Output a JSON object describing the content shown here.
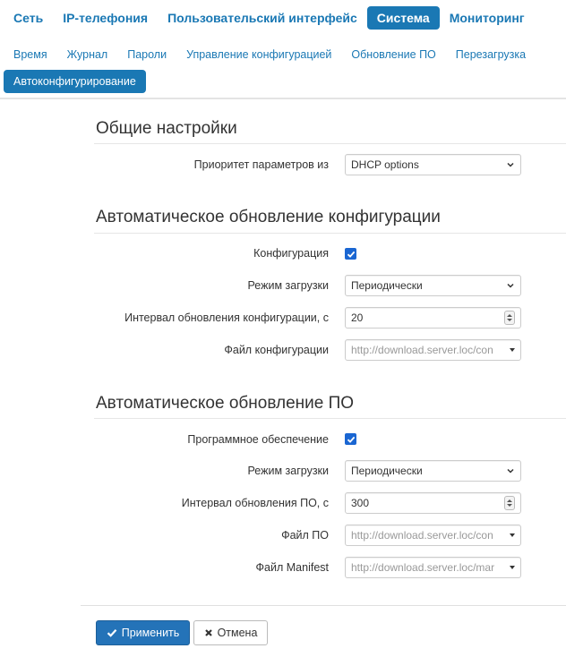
{
  "topnav": {
    "items": [
      "Сеть",
      "IP-телефония",
      "Пользовательский интерфейс",
      "Система",
      "Мониторинг"
    ],
    "active": "Система"
  },
  "subnav": {
    "items": [
      "Время",
      "Журнал",
      "Пароли",
      "Управление конфигурацией",
      "Обновление ПО",
      "Перезагрузка",
      "Автоконфигурирование"
    ],
    "active": "Автоконфигурирование"
  },
  "general": {
    "title": "Общие настройки",
    "priority_label": "Приоритет параметров из",
    "priority_value": "DHCP options"
  },
  "config_update": {
    "title": "Автоматическое обновление конфигурации",
    "enabled_label": "Конфигурация",
    "enabled": true,
    "mode_label": "Режим загрузки",
    "mode_value": "Периодически",
    "interval_label": "Интервал обновления конфигурации, с",
    "interval_value": "20",
    "file_label": "Файл конфигурации",
    "file_placeholder": "http://download.server.loc/con"
  },
  "fw_update": {
    "title": "Автоматическое обновление ПО",
    "enabled_label": "Программное обеспечение",
    "enabled": true,
    "mode_label": "Режим загрузки",
    "mode_value": "Периодически",
    "interval_label": "Интервал обновления ПО, с",
    "interval_value": "300",
    "file_label": "Файл ПО",
    "file_placeholder": "http://download.server.loc/con",
    "manifest_label": "Файл Manifest",
    "manifest_placeholder": "http://download.server.loc/mar"
  },
  "buttons": {
    "apply": "Применить",
    "cancel": "Отмена"
  },
  "colors": {
    "accent": "#1a78b4",
    "checkbox": "#1a66d2"
  }
}
